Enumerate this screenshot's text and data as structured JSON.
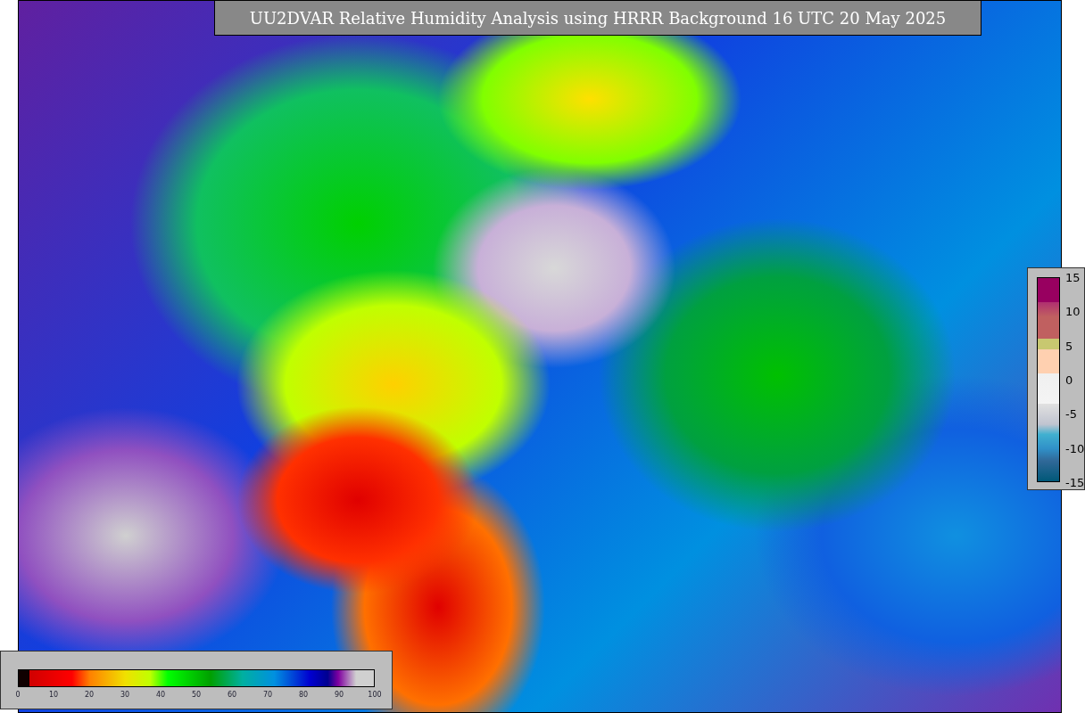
{
  "title": "UU2DVAR Relative Humidity Analysis using HRRR Background 16 UTC 20 May 2025",
  "humidity_legend": {
    "ticks": [
      "0",
      "10",
      "20",
      "30",
      "40",
      "50",
      "60",
      "70",
      "80",
      "90",
      "100"
    ]
  },
  "side_legend": {
    "ticks": [
      "15",
      "10",
      "5",
      "0",
      "-5",
      "-10",
      "-15"
    ]
  }
}
